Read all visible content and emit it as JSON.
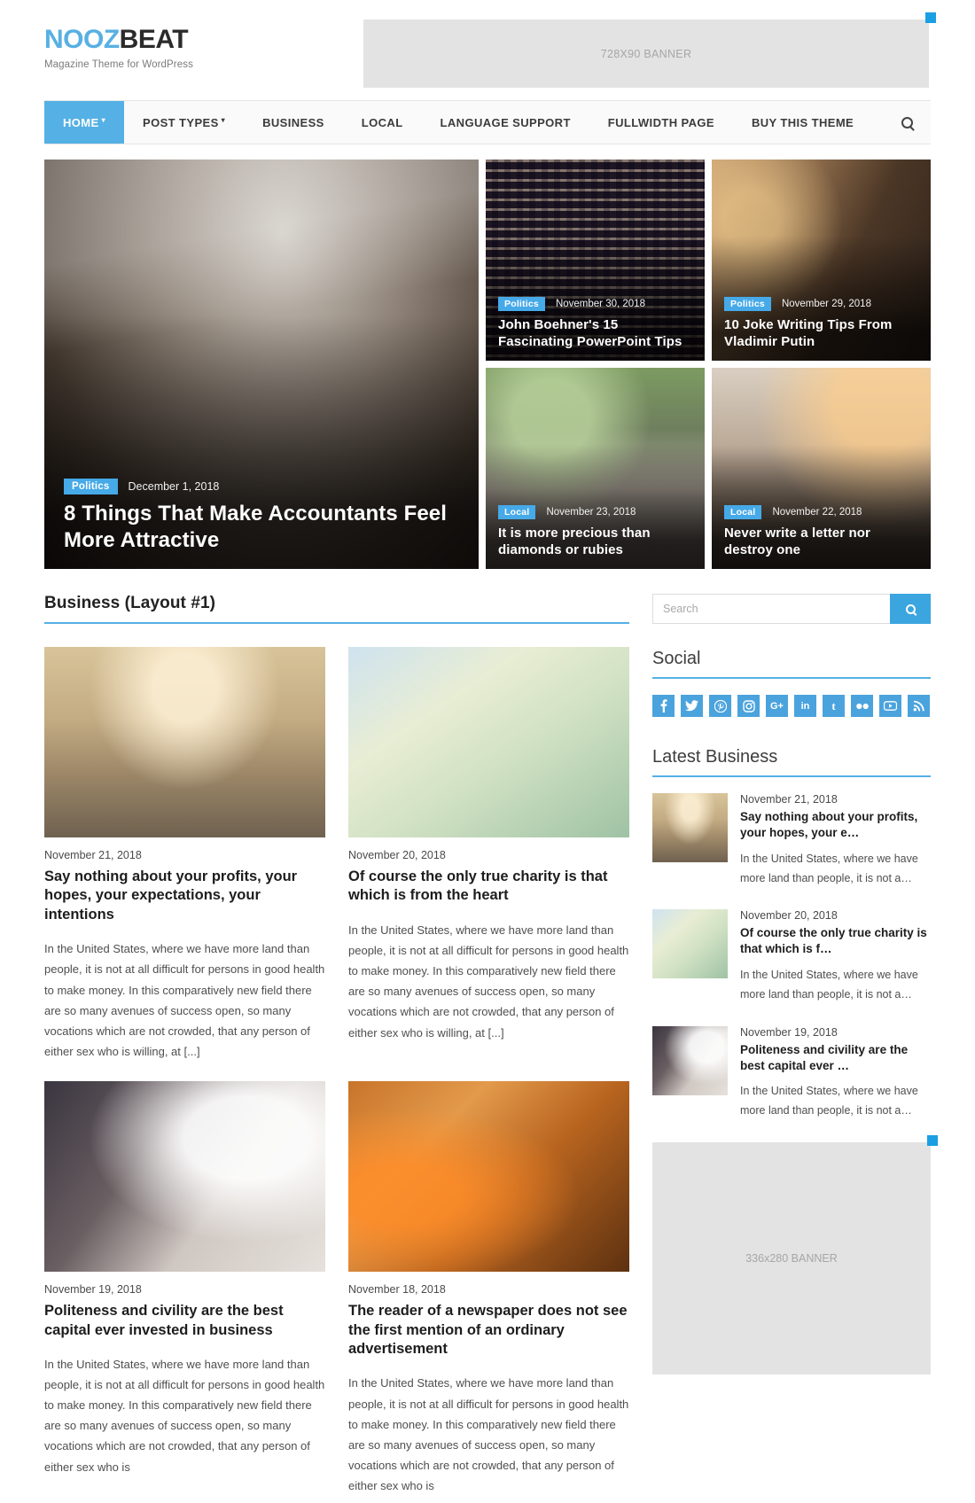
{
  "site": {
    "logo_primary": "NOOZ",
    "logo_secondary": "BEAT",
    "tagline": "Magazine Theme for WordPress",
    "accent_color": "#55b0e5",
    "badge_color": "#46a9e8"
  },
  "top_banner": {
    "label": "728X90 BANNER"
  },
  "nav": {
    "items": [
      {
        "label": "HOME",
        "active": true,
        "has_dropdown": true
      },
      {
        "label": "POST TYPES",
        "active": false,
        "has_dropdown": true
      },
      {
        "label": "BUSINESS",
        "active": false,
        "has_dropdown": false
      },
      {
        "label": "LOCAL",
        "active": false,
        "has_dropdown": false
      },
      {
        "label": "LANGUAGE SUPPORT",
        "active": false,
        "has_dropdown": false
      },
      {
        "label": "FULLWIDTH PAGE",
        "active": false,
        "has_dropdown": false
      },
      {
        "label": "BUY THIS THEME",
        "active": false,
        "has_dropdown": false
      }
    ],
    "search_icon": "search-icon"
  },
  "hero": {
    "featured": {
      "category": "Politics",
      "date": "December 1, 2018",
      "title": "8 Things That Make Accountants Feel More Attractive"
    },
    "tiles": [
      {
        "category": "Politics",
        "date": "November 30, 2018",
        "title": "John Boehner's 15 Fascinating PowerPoint Tips"
      },
      {
        "category": "Politics",
        "date": "November 29, 2018",
        "title": "10 Joke Writing Tips From Vladimir Putin"
      },
      {
        "category": "Local",
        "date": "November 23, 2018",
        "title": "It is more precious than diamonds or rubies"
      },
      {
        "category": "Local",
        "date": "November 22, 2018",
        "title": "Never write a letter nor destroy one"
      }
    ]
  },
  "main": {
    "section_title": "Business (Layout #1)",
    "posts": [
      {
        "date": "November 21, 2018",
        "title": "Say nothing about your profits, your hopes, your expectations, your intentions",
        "excerpt": "In the United States, where we have more land than people, it is not at all difficult for persons in good health to make money. In this comparatively new field there are so many avenues of success open, so many vocations which are not crowded, that any person of either sex who is willing, at [...]"
      },
      {
        "date": "November 20, 2018",
        "title": "Of course the only true charity is that which is from the heart",
        "excerpt": "In the United States, where we have more land than people, it is not at all difficult for persons in good health to make money. In this comparatively new field there are so many avenues of success open, so many vocations which are not crowded, that any person of either sex who is willing, at [...]"
      },
      {
        "date": "November 19, 2018",
        "title": "Politeness and civility are the best capital ever invested in business",
        "excerpt": "In the United States, where we have more land than people, it is not at all difficult for persons in good health to make money. In this comparatively new field there are so many avenues of success open, so many vocations which are not crowded, that any person of either sex who is"
      },
      {
        "date": "November 18, 2018",
        "title": "The reader of a newspaper does not see the first mention of an ordinary advertisement",
        "excerpt": "In the United States, where we have more land than people, it is not at all difficult for persons in good health to make money. In this comparatively new field there are so many avenues of success open, so many vocations which are not crowded, that any person of either sex who is"
      }
    ]
  },
  "sidebar": {
    "search": {
      "placeholder": "Search",
      "value": "",
      "button_icon": "search-icon"
    },
    "social": {
      "title": "Social",
      "items": [
        {
          "name": "facebook",
          "glyph": "f"
        },
        {
          "name": "twitter",
          "glyph": "t"
        },
        {
          "name": "pinterest",
          "glyph": "P"
        },
        {
          "name": "instagram",
          "glyph": "o"
        },
        {
          "name": "google-plus",
          "glyph": "G+"
        },
        {
          "name": "linkedin",
          "glyph": "in"
        },
        {
          "name": "tumblr",
          "glyph": "t"
        },
        {
          "name": "flickr",
          "glyph": "••"
        },
        {
          "name": "youtube",
          "glyph": "▶"
        },
        {
          "name": "rss",
          "glyph": "•))"
        }
      ]
    },
    "latest": {
      "title": "Latest Business",
      "items": [
        {
          "date": "November 21, 2018",
          "title": "Say nothing about your profits, your hopes, your e…",
          "excerpt": "In the United States, where we have more land than people, it is not a…"
        },
        {
          "date": "November 20, 2018",
          "title": "Of course the only true charity is that which is f…",
          "excerpt": "In the United States, where we have more land than people, it is not a…"
        },
        {
          "date": "November 19, 2018",
          "title": "Politeness and civility are the best capital ever …",
          "excerpt": "In the United States, where we have more land than people, it is not a…"
        }
      ]
    },
    "banner": {
      "label": "336x280 BANNER"
    }
  }
}
